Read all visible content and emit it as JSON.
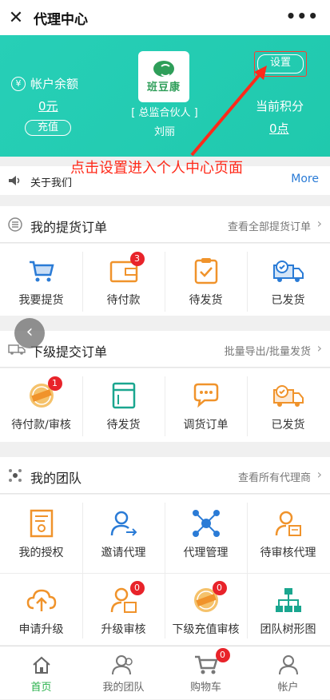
{
  "topbar": {
    "title": "代理中心",
    "more": "•••"
  },
  "account": {
    "balance_label": "帐户余额",
    "balance_value": "0元",
    "recharge": "充值",
    "logo_text": "班豆康",
    "role": "[ 总监合伙人 ]",
    "name": "刘丽",
    "settings": "设置",
    "points_label": "当前积分",
    "points_value": "0点"
  },
  "annotation": "点击设置进入个人中心页面",
  "notice": {
    "text": "关于我们",
    "more": "More"
  },
  "pickup": {
    "title": "我的提货订单",
    "link": "查看全部提货订单",
    "items": [
      {
        "label": "我要提货"
      },
      {
        "label": "待付款",
        "badge": "3"
      },
      {
        "label": "待发货"
      },
      {
        "label": "已发货"
      }
    ]
  },
  "sub": {
    "title": "下级提交订单",
    "link": "批量导出/批量发货",
    "items": [
      {
        "label": "待付款/审核",
        "badge": "1"
      },
      {
        "label": "待发货"
      },
      {
        "label": "调货订单"
      },
      {
        "label": "已发货"
      }
    ]
  },
  "team": {
    "title": "我的团队",
    "link": "查看所有代理商",
    "items": [
      {
        "label": "我的授权"
      },
      {
        "label": "邀请代理"
      },
      {
        "label": "代理管理"
      },
      {
        "label": "待审核代理"
      },
      {
        "label": "申请升级"
      },
      {
        "label": "升级审核",
        "badge": "0"
      },
      {
        "label": "下级充值审核",
        "badge": "0"
      },
      {
        "label": "团队树形图"
      }
    ]
  },
  "tabs": [
    {
      "label": "首页"
    },
    {
      "label": "我的团队"
    },
    {
      "label": "购物车",
      "badge": "0"
    },
    {
      "label": "帐户"
    }
  ],
  "colors": {
    "accent": "#f0932b",
    "teal": "#26c6b0",
    "red": "#ff2a1a",
    "green": "#28b14b",
    "blue": "#2a7bd6"
  }
}
